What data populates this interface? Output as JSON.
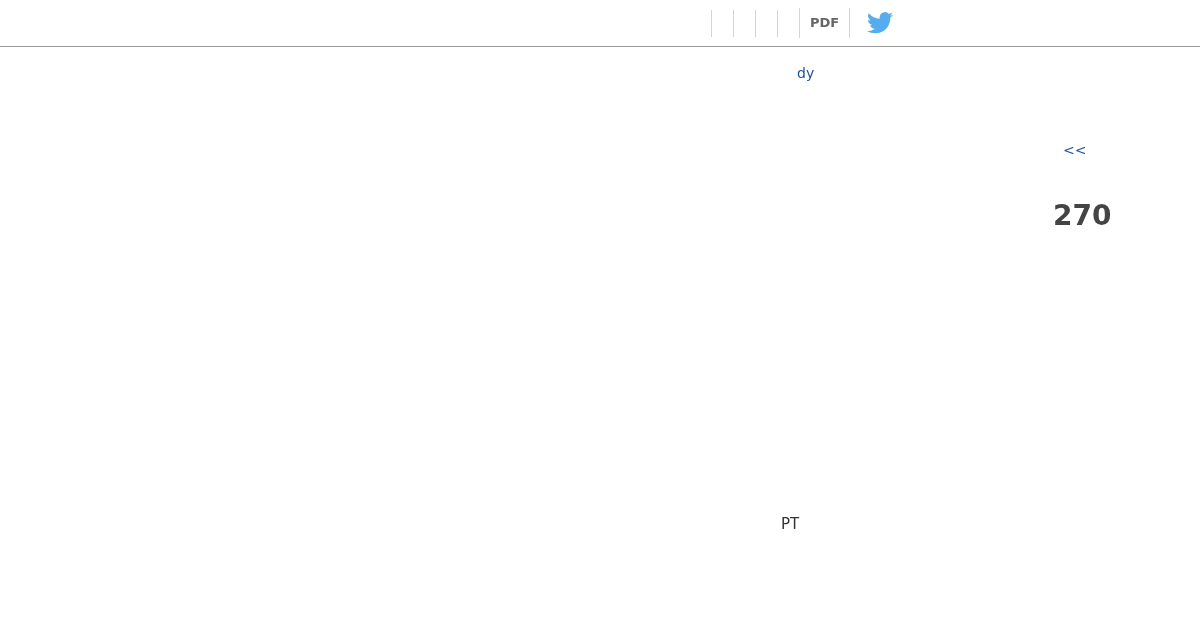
{
  "header": {
    "toolbar": {
      "pdf_label": "PDF"
    }
  },
  "content": {
    "link": "dy",
    "back_link": "<<",
    "number": "270",
    "footer_text": "PT"
  }
}
